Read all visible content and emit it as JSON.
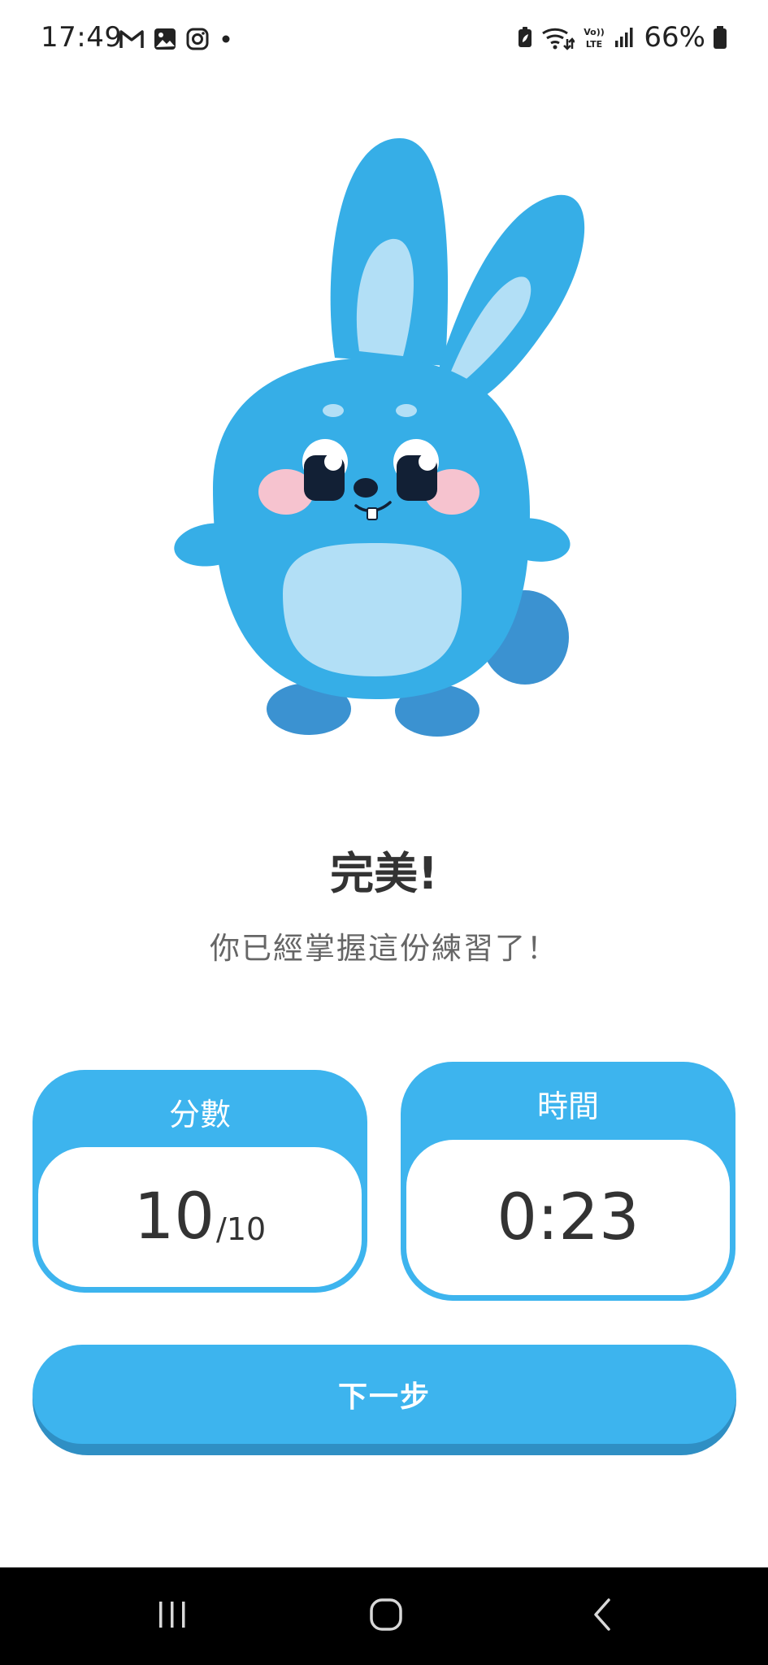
{
  "status_bar": {
    "time": "17:49",
    "notification_icons": [
      "gmail-icon",
      "gallery-icon",
      "instagram-icon",
      "more-dot-icon"
    ],
    "system_icons": [
      "battery-saver-icon",
      "wifi-icon",
      "volte-icon",
      "signal-icon",
      "battery-icon"
    ],
    "volte_label": "Vo))\nLTE",
    "battery_percent": "66%"
  },
  "result": {
    "title": "完美!",
    "subtitle": "你已經掌握這份練習了！"
  },
  "stats": {
    "score": {
      "label": "分數",
      "value": "10",
      "suffix": "/10"
    },
    "time": {
      "label": "時間",
      "value": "0:23"
    }
  },
  "next_button": {
    "label": "下一步"
  },
  "nav_bar": {
    "buttons": [
      "recents-icon",
      "home-icon",
      "back-icon"
    ]
  },
  "colors": {
    "accent": "#3db4ee",
    "accent_shadow": "#2f8fc4",
    "mascot_body": "#36aee7",
    "mascot_belly": "#b2dff6",
    "mascot_feet": "#3b92d1",
    "cheek": "#f6c3cf",
    "eye": "#122035"
  }
}
